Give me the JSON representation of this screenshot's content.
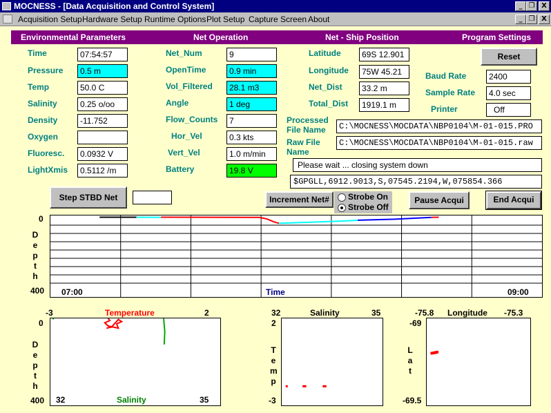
{
  "window": {
    "title": "MOCNESS - [Data Acquisition and Control System]",
    "buttons": [
      "_",
      "❐",
      "X"
    ]
  },
  "menu": [
    "Acquisition Setup",
    "Hardware Setup",
    "Runtime Options",
    "Plot Setup",
    "Capture Screen",
    "About"
  ],
  "headers": {
    "environmental": "Environmental Parameters",
    "net_operation": "Net Operation",
    "ship_position": "Net - Ship Position",
    "program_settings": "Program Settings"
  },
  "environmental": [
    {
      "label": "Time",
      "value": "07:54:57",
      "highlight": "none"
    },
    {
      "label": "Pressure",
      "value": "0.5 m",
      "highlight": "cyan"
    },
    {
      "label": "Temp",
      "value": "50.0 C",
      "highlight": "none"
    },
    {
      "label": "Salinity",
      "value": "0.25 o/oo",
      "highlight": "none"
    },
    {
      "label": "Density",
      "value": "-11.752",
      "highlight": "none"
    },
    {
      "label": "Oxygen",
      "value": "",
      "highlight": "none"
    },
    {
      "label": "Fluoresc.",
      "value": "0.0932 V",
      "highlight": "none"
    },
    {
      "label": "LightXmis",
      "value": "0.5112 /m",
      "highlight": "none"
    }
  ],
  "net": [
    {
      "label": "Net_Num",
      "value": "9",
      "highlight": "none"
    },
    {
      "label": "OpenTime",
      "value": "0.9 min",
      "highlight": "cyan"
    },
    {
      "label": "Vol_Filtered",
      "value": "28.1 m3",
      "highlight": "cyan"
    },
    {
      "label": "Angle",
      "value": "1 deg",
      "highlight": "cyan"
    },
    {
      "label": "Flow_Counts",
      "value": "7",
      "highlight": "none"
    },
    {
      "label": "Hor_Vel",
      "value": "0.3 kts",
      "highlight": "none"
    },
    {
      "label": "Vert_Vel",
      "value": "1.0 m/min",
      "highlight": "none"
    },
    {
      "label": "Battery",
      "value": "19.8 V",
      "highlight": "green"
    }
  ],
  "position": [
    {
      "label": "Latitude",
      "value": "69S 12.901"
    },
    {
      "label": "Longitude",
      "value": "75W 45.21"
    },
    {
      "label": "Net_Dist",
      "value": "33.2 m"
    },
    {
      "label": "Total_Dist",
      "value": "1919.1 m"
    }
  ],
  "settings": {
    "reset": "Reset",
    "baud_label": "Baud Rate",
    "baud": "2400",
    "sample_label": "Sample Rate",
    "sample": "4.0 sec",
    "printer_label": "Printer",
    "printer": "Off"
  },
  "files": {
    "processed_label": "Processed\nFile Name",
    "processed": "C:\\MOCNESS\\MOCDATA\\NBP0104\\M-01-015.PRO",
    "raw_label": "Raw File\nName",
    "raw": "C:\\MOCNESS\\MOCDATA\\NBP0104\\M-01-015.raw"
  },
  "status_message": "Please wait ... closing system down",
  "gps_string": "$GPGLL,6912.9013,S,07545.2194,W,075854.366",
  "controls": {
    "step_net": "Step STBD Net",
    "increment": "Increment Net#",
    "strobe_on": "Strobe On",
    "strobe_off": "Strobe Off",
    "strobe_selected": "off",
    "pause": "Pause Acqui",
    "end": "End Acqui"
  },
  "chart_data": [
    {
      "type": "line",
      "id": "depth-time",
      "ylabel": "Depth",
      "xlabel": "Time",
      "x_ticks": [
        "07:00",
        "09:00"
      ],
      "y_ticks": [
        "0",
        "400"
      ],
      "xlim_hours": [
        7.0,
        9.0
      ],
      "ylim": [
        0,
        400
      ],
      "grid": true,
      "series": [
        {
          "color": "#000000",
          "points": [
            [
              7.2,
              2
            ],
            [
              7.35,
              2
            ]
          ]
        },
        {
          "color": "#00FFFF",
          "points": [
            [
              7.35,
              2
            ],
            [
              7.45,
              3
            ]
          ]
        },
        {
          "color": "#FF0000",
          "points": [
            [
              7.45,
              2
            ],
            [
              7.85,
              3
            ],
            [
              7.88,
              12
            ],
            [
              7.91,
              30
            ],
            [
              7.93,
              38
            ]
          ]
        },
        {
          "color": "#00FFFF",
          "points": [
            [
              7.93,
              38
            ],
            [
              8.05,
              32
            ],
            [
              8.2,
              24
            ],
            [
              8.25,
              20
            ]
          ]
        },
        {
          "color": "#0000FF",
          "points": [
            [
              8.25,
              20
            ],
            [
              8.4,
              14
            ],
            [
              8.55,
              3
            ]
          ]
        },
        {
          "color": "#FF0000",
          "points": [
            [
              8.55,
              3
            ],
            [
              8.58,
              2
            ]
          ]
        }
      ]
    },
    {
      "type": "line",
      "id": "temp-sal-depth",
      "title": "Temperature",
      "xlabel": "Salinity",
      "ylabel": "Depth",
      "top_ticks": [
        "-3",
        "2"
      ],
      "bottom_ticks": [
        "32",
        "35"
      ],
      "y_ticks": [
        "0",
        "400"
      ],
      "xlim_temp": [
        -3,
        2
      ],
      "xlim_sal": [
        32,
        35
      ],
      "ylim": [
        0,
        400
      ],
      "series": [
        {
          "name": "Temperature",
          "color": "#FF0000",
          "points": [
            [
              -1.3,
              0
            ],
            [
              -1.25,
              10
            ],
            [
              -1.4,
              20
            ],
            [
              -1.3,
              35
            ],
            [
              -1.0,
              45
            ],
            [
              -1.05,
              25
            ],
            [
              -0.9,
              15
            ],
            [
              -1.0,
              5
            ],
            [
              -1.2,
              40
            ],
            [
              -1.35,
              45
            ]
          ]
        },
        {
          "name": "Salinity",
          "color": "#00AA00",
          "points": [
            [
              34.0,
              0
            ],
            [
              34.02,
              60
            ],
            [
              34.01,
              120
            ]
          ]
        },
        {
          "name": "Salinity",
          "color": "#00AA00",
          "points": [
            [
              32.05,
              0
            ],
            [
              32.05,
              5
            ]
          ]
        }
      ]
    },
    {
      "type": "scatter",
      "id": "salinity-temp",
      "title": "Salinity",
      "ylabel": "Temp",
      "x_ticks": [
        "32",
        "35"
      ],
      "y_ticks": [
        "2",
        "-3"
      ],
      "xlim": [
        32,
        35
      ],
      "ylim": [
        -3,
        2
      ],
      "series": [
        {
          "color": "#FF0000",
          "points": [
            [
              32.15,
              -1.9
            ],
            [
              32.65,
              -1.9
            ],
            [
              32.7,
              -1.9
            ],
            [
              33.25,
              -1.9
            ],
            [
              33.3,
              -1.9
            ]
          ]
        }
      ]
    },
    {
      "type": "scatter",
      "id": "lon-lat",
      "title": "Longitude",
      "ylabel": "Lat",
      "x_ticks": [
        "-75.8",
        "-75.3"
      ],
      "y_ticks": [
        "-69",
        "-69.5"
      ],
      "xlim": [
        -75.8,
        -75.3
      ],
      "ylim": [
        -69.5,
        -69
      ],
      "series": [
        {
          "color": "#FF0000",
          "points": [
            [
              -75.775,
              -69.2
            ],
            [
              -75.765,
              -69.198
            ],
            [
              -75.757,
              -69.196
            ],
            [
              -75.75,
              -69.194
            ]
          ]
        }
      ]
    }
  ]
}
